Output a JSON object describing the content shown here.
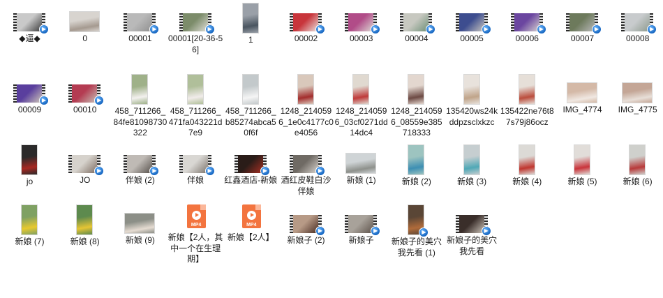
{
  "folder_view": {
    "items": [
      {
        "name": "◆逼◆",
        "kind": "video",
        "colors": [
          "#c9c9c9",
          "#3a3a3a"
        ]
      },
      {
        "name": "0",
        "kind": "photo-wide",
        "colors": [
          "#d8d4cf",
          "#a59a90"
        ]
      },
      {
        "name": "00001",
        "kind": "video",
        "colors": [
          "#b9b9b9",
          "#8f8f8f"
        ]
      },
      {
        "name": "00001[20-36-56]",
        "kind": "video",
        "colors": [
          "#7c8c6a",
          "#e1dfda"
        ]
      },
      {
        "name": "1",
        "kind": "photo-tall",
        "colors": [
          "#9aa0a8",
          "#4a5560"
        ]
      },
      {
        "name": "00002",
        "kind": "video",
        "colors": [
          "#c8353b",
          "#e9e4e0"
        ]
      },
      {
        "name": "00003",
        "kind": "video",
        "colors": [
          "#b14c88",
          "#dcd9d4"
        ]
      },
      {
        "name": "00004",
        "kind": "video",
        "colors": [
          "#c7c8c0",
          "#6d8f77"
        ]
      },
      {
        "name": "00005",
        "kind": "video",
        "colors": [
          "#3d4d8f",
          "#c9c6bf"
        ]
      },
      {
        "name": "00006",
        "kind": "video",
        "colors": [
          "#6b46a0",
          "#d7d3cf"
        ]
      },
      {
        "name": "00007",
        "kind": "video",
        "colors": [
          "#6d7a5c",
          "#b8b8b8"
        ]
      },
      {
        "name": "00008",
        "kind": "video",
        "colors": [
          "#c8cbcd",
          "#8d9a8e"
        ]
      },
      {
        "name": "00009",
        "kind": "video",
        "colors": [
          "#5a3f9e",
          "#cfc7b8"
        ]
      },
      {
        "name": "00010",
        "kind": "video",
        "colors": [
          "#b43c52",
          "#c6c1b8"
        ]
      },
      {
        "name": "458_711266_84fe81098730322",
        "kind": "photo-tall",
        "colors": [
          "#9fb189",
          "#f3f1ef"
        ]
      },
      {
        "name": "458_711266_471fa043221d7e9",
        "kind": "photo-tall",
        "colors": [
          "#b0bf9a",
          "#f1ecea"
        ]
      },
      {
        "name": "458_711266_b85274abca50f6f",
        "kind": "photo-tall",
        "colors": [
          "#c3c9cb",
          "#f5f5f5"
        ]
      },
      {
        "name": "1248_2140596_1e0c4177c0e4056",
        "kind": "photo-tall",
        "colors": [
          "#d9c8bb",
          "#a32d2d"
        ]
      },
      {
        "name": "1248_2140596_03cf0271dd14dc4",
        "kind": "photo-tall",
        "colors": [
          "#e0d9d0",
          "#bf3a3a"
        ]
      },
      {
        "name": "1248_2140596_08559e385718333",
        "kind": "photo-tall",
        "colors": [
          "#e3d7cf",
          "#6d4a44"
        ]
      },
      {
        "name": "135420ws24kddpzsclxkzc",
        "kind": "photo-tall",
        "colors": [
          "#e8e2dc",
          "#c0a48a"
        ]
      },
      {
        "name": "135422ne76t87s79j86ocz",
        "kind": "photo-tall",
        "colors": [
          "#e6dfd8",
          "#bb4d3d"
        ]
      },
      {
        "name": "IMG_4774",
        "kind": "photo-wide",
        "colors": [
          "#d4b9a7",
          "#f0e8e2"
        ]
      },
      {
        "name": "IMG_4775",
        "kind": "photo-wide",
        "colors": [
          "#c4a696",
          "#e8dfd8"
        ]
      },
      {
        "name": "jo",
        "kind": "photo-tall",
        "colors": [
          "#2b2a2a",
          "#a72822"
        ]
      },
      {
        "name": "JO",
        "kind": "video",
        "colors": [
          "#d6d2cc",
          "#7d6c61"
        ]
      },
      {
        "name": "伴娘 (2)",
        "kind": "video",
        "colors": [
          "#bfbab5",
          "#56504b"
        ]
      },
      {
        "name": "伴娘",
        "kind": "video",
        "colors": [
          "#d9d7d3",
          "#7c746c"
        ]
      },
      {
        "name": "红鑫酒店-新娘",
        "kind": "video",
        "colors": [
          "#2a1c18",
          "#a83024"
        ]
      },
      {
        "name": "酒红皮鞋白沙伴娘",
        "kind": "video",
        "colors": [
          "#6f6a64",
          "#d9d4ce"
        ]
      },
      {
        "name": "新娘 (1)",
        "kind": "photo-wide",
        "colors": [
          "#cfd4d6",
          "#8e918c"
        ]
      },
      {
        "name": "新娘 (2)",
        "kind": "photo-tall",
        "colors": [
          "#9dc4c0",
          "#3d8fb3"
        ]
      },
      {
        "name": "新娘 (3)",
        "kind": "photo-tall",
        "colors": [
          "#c6ced0",
          "#4fa8b6"
        ]
      },
      {
        "name": "新娘 (4)",
        "kind": "photo-tall",
        "colors": [
          "#dcdad6",
          "#c0362f"
        ]
      },
      {
        "name": "新娘 (5)",
        "kind": "photo-tall",
        "colors": [
          "#e1ddd9",
          "#c9333a"
        ]
      },
      {
        "name": "新娘 (6)",
        "kind": "photo-tall",
        "colors": [
          "#cfd0cc",
          "#b83a3a"
        ]
      },
      {
        "name": "新娘 (7)",
        "kind": "photo-tall",
        "colors": [
          "#7fa163",
          "#e8c92e"
        ]
      },
      {
        "name": "新娘 (8)",
        "kind": "photo-tall",
        "colors": [
          "#5d8a4e",
          "#e6c534"
        ]
      },
      {
        "name": "新娘 (9)",
        "kind": "photo-wide",
        "colors": [
          "#8c8f87",
          "#e6dcd2"
        ]
      },
      {
        "name": "新娘【2人，其中一个在生理期】",
        "kind": "mp4-doc"
      },
      {
        "name": "新娘【2人】",
        "kind": "mp4-doc"
      },
      {
        "name": "新娘子 (2)",
        "kind": "video",
        "colors": [
          "#b79a86",
          "#4a2e24"
        ]
      },
      {
        "name": "新娘子",
        "kind": "video",
        "colors": [
          "#a8a29a",
          "#5e534b"
        ]
      },
      {
        "name": "新娘子的美穴我先看 (1)",
        "kind": "photo-tall-badge",
        "colors": [
          "#5a4636",
          "#b06b3a"
        ]
      },
      {
        "name": "新娘子的美穴我先看",
        "kind": "video",
        "colors": [
          "#3a2e2a",
          "#cfc7bd"
        ]
      }
    ],
    "mp4_tag": "MP4",
    "badge_icon": "media-player-badge-icon"
  }
}
